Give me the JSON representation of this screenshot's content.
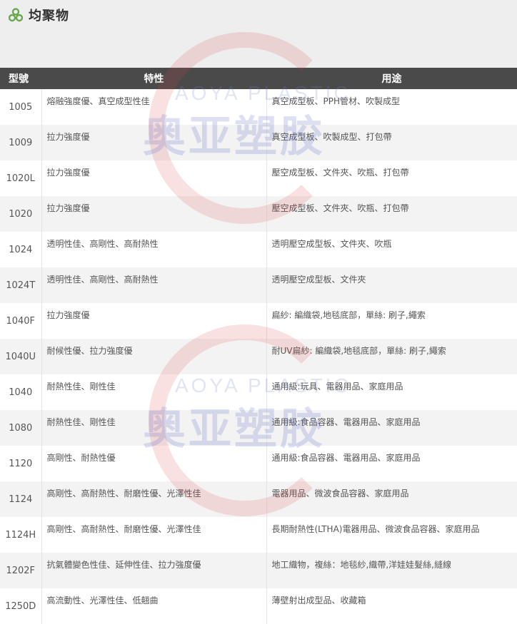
{
  "page": {
    "title": "均聚物",
    "icon": "molecule-icon",
    "accent_green": "#6aa84f",
    "header_bg": "#4a4a4a"
  },
  "table": {
    "headers": {
      "model": "型號",
      "property": "特性",
      "usage": "用途"
    },
    "rows": [
      {
        "model": "1005",
        "property": "熔融強度優、真空成型性佳",
        "usage": "真空成型板、PPH管材、吹製成型"
      },
      {
        "model": "1009",
        "property": "拉力強度優",
        "usage": "真空成型板、吹製成型、打包帶"
      },
      {
        "model": "1020L",
        "property": "拉力強度優",
        "usage": "壓空成型板、文件夾、吹瓶、打包帶"
      },
      {
        "model": "1020",
        "property": "拉力強度優",
        "usage": "壓空成型板、文件夾、吹瓶、打包帶"
      },
      {
        "model": "1024",
        "property": "透明性佳、高剛性、高耐熱性",
        "usage": "透明壓空成型板、文件夾、吹瓶"
      },
      {
        "model": "1024T",
        "property": "透明性佳、高剛性、高耐熱性",
        "usage": "透明壓空成型板、文件夾"
      },
      {
        "model": "1040F",
        "property": "拉力強度優",
        "usage": "扁紗: 編織袋,地毯底部，單絲: 刷子,繩索"
      },
      {
        "model": "1040U",
        "property": "耐候性優、拉力強度優",
        "usage": "耐UV扁紗: 編織袋,地毯底部，單絲: 刷子,繩索"
      },
      {
        "model": "1040",
        "property": "耐熱性佳、剛性佳",
        "usage": "通用級:玩具、電器用品、家庭用品"
      },
      {
        "model": "1080",
        "property": "耐熱性佳、剛性佳",
        "usage": "通用級:食品容器、電器用品、家庭用品"
      },
      {
        "model": "1120",
        "property": "高剛性、耐熱性優",
        "usage": "通用級:食品容器、電器用品、家庭用品"
      },
      {
        "model": "1124",
        "property": "高剛性、高耐熱性、耐磨性優、光澤性佳",
        "usage": "電器用品、微波食品容器、家庭用品"
      },
      {
        "model": "1124H",
        "property": "高剛性、高耐熱性、耐磨性優、光澤性佳",
        "usage": "長期耐熱性(LTHA)電器用品、微波食品容器、家庭用品"
      },
      {
        "model": "1202F",
        "property": "抗氣體變色性佳、延伸性佳、拉力強度優",
        "usage": "地工織物，複絲：地毯紗,織帶,洋娃娃髮絲,縫線"
      },
      {
        "model": "1250D",
        "property": "高流動性、光澤性佳、低翹曲",
        "usage": "薄壁射出成型品、收藏箱"
      }
    ]
  },
  "watermark": {
    "en": "AOYA PLASTIC",
    "cn": "奥亚塑胶"
  }
}
